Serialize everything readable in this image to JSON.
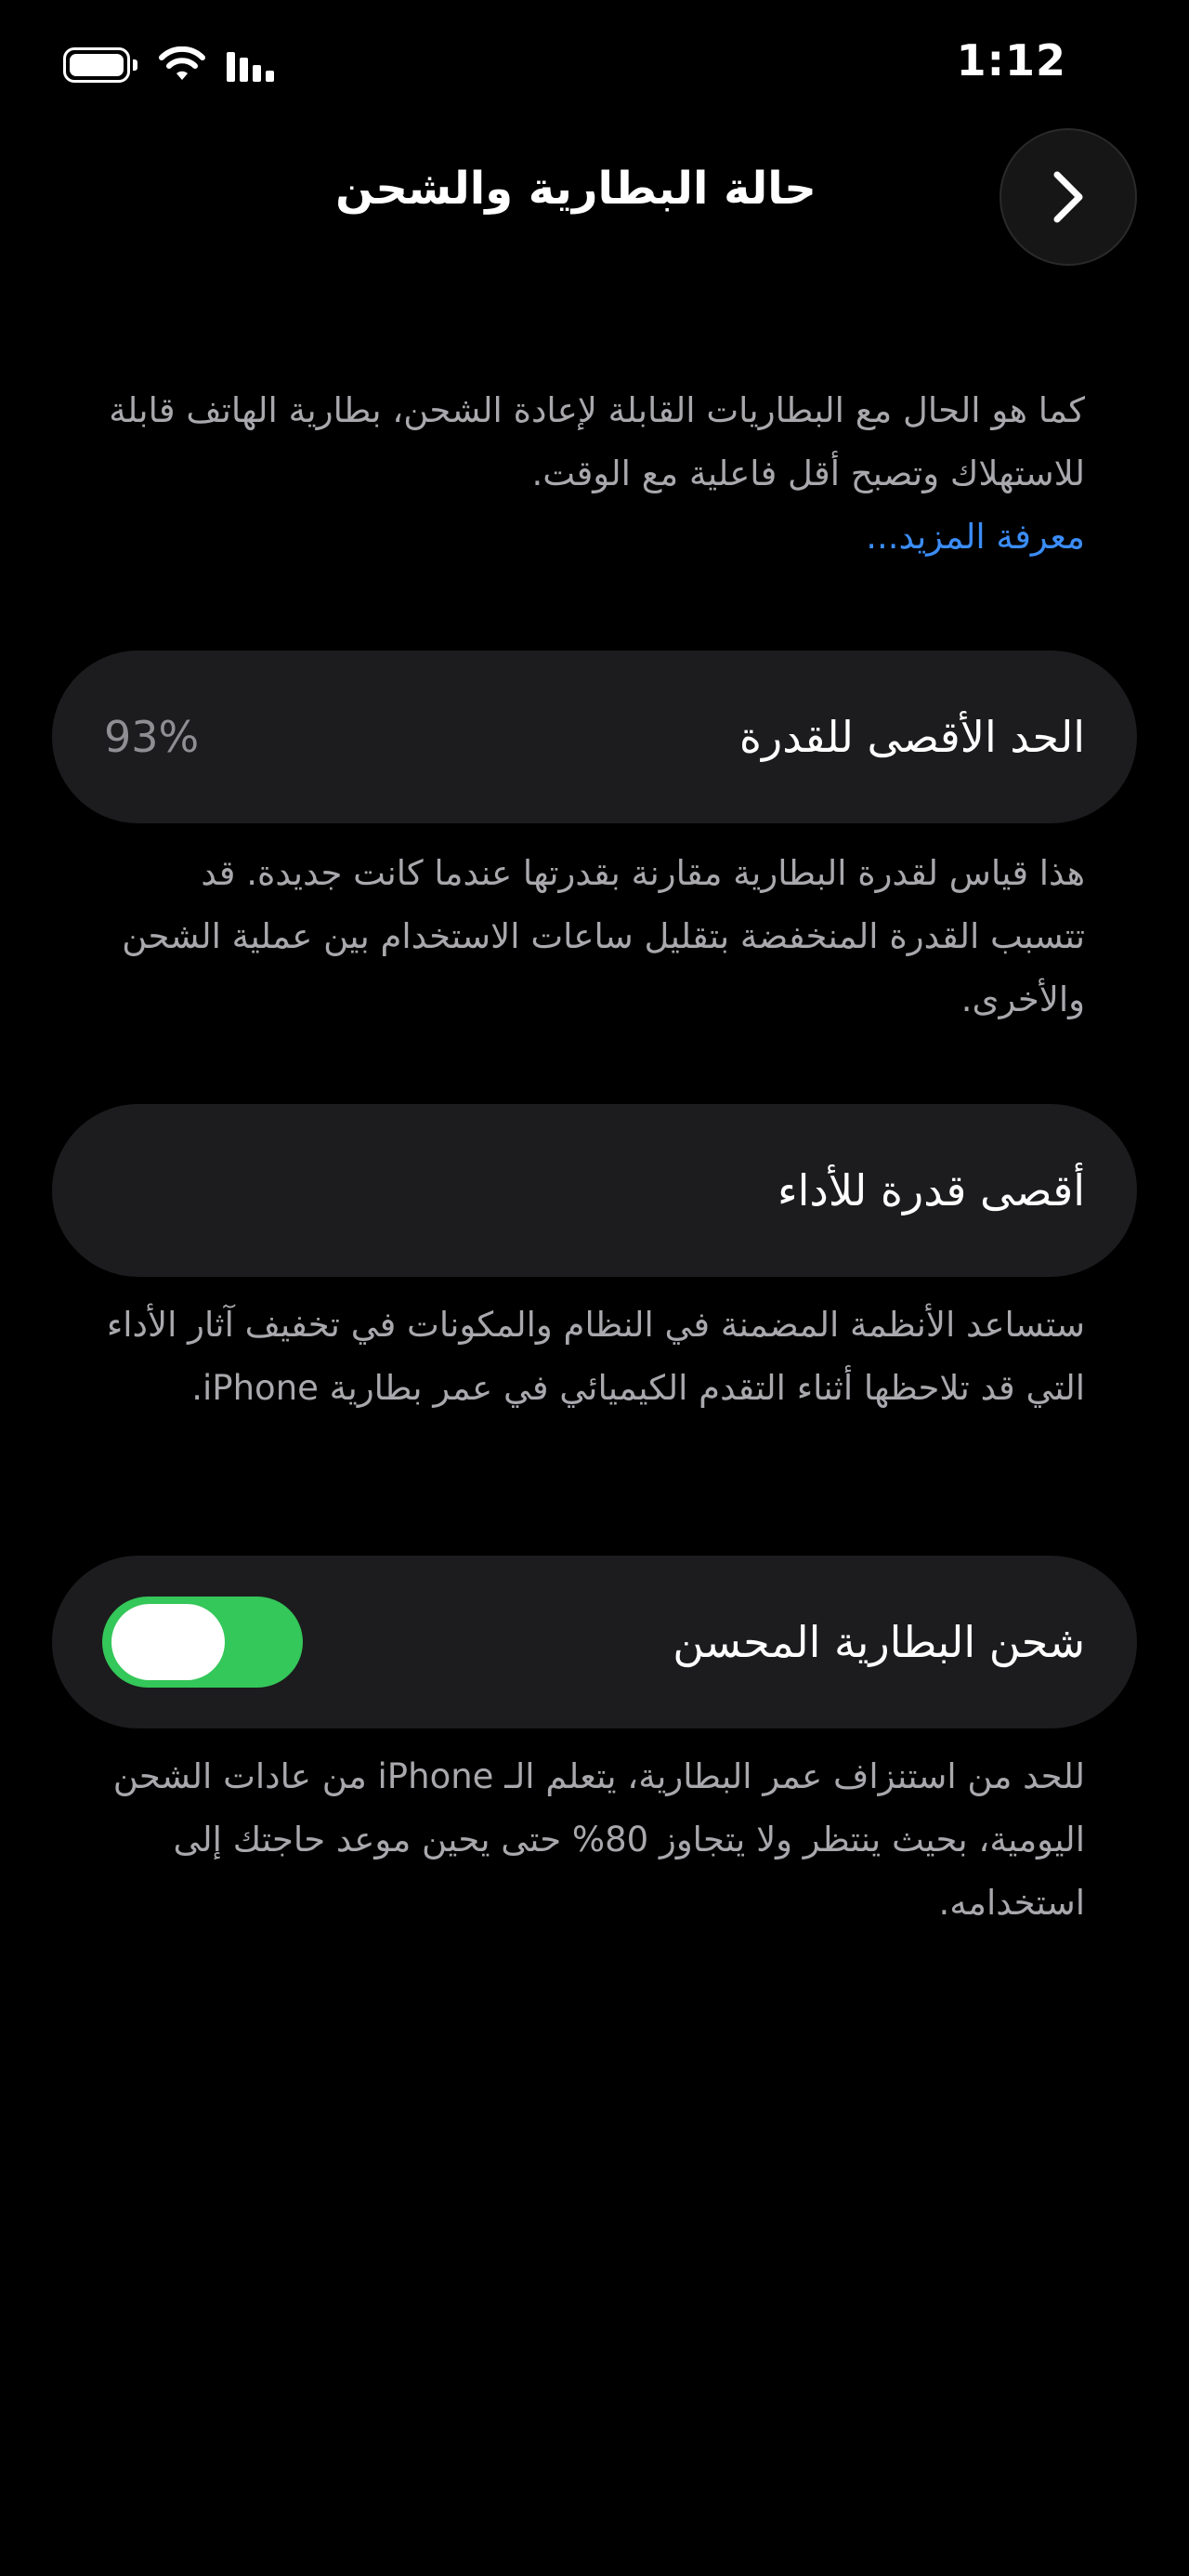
{
  "status_bar": {
    "time": "1:12"
  },
  "nav": {
    "title": "حالة البطارية والشحن"
  },
  "intro": {
    "text": "كما هو الحال مع البطاريات القابلة لإعادة الشحن، بطارية الهاتف قابلة للاستهلاك وتصبح أقل فاعلية مع الوقت.",
    "link": "معرفة المزيد..."
  },
  "max_capacity": {
    "label": "الحد الأقصى للقدرة",
    "value": "93%",
    "description": "هذا قياس لقدرة البطارية مقارنة بقدرتها عندما كانت جديدة. قد تتسبب القدرة المنخفضة بتقليل ساعات الاستخدام بين عملية الشحن والأخرى."
  },
  "peak_performance": {
    "label": "أقصى قدرة للأداء",
    "description": "ستساعد الأنظمة المضمنة في النظام والمكونات في تخفيف آثار الأداء التي قد تلاحظها أثناء التقدم الكيميائي في عمر بطارية iPhone."
  },
  "optimized_charging": {
    "label": "شحن البطارية المحسن",
    "enabled": true,
    "description": "للحد من استنزاف عمر البطارية، يتعلم الـ iPhone من عادات الشحن اليومية، بحيث ينتظر ولا يتجاوز 80% حتى يحين موعد حاجتك إلى استخدامه."
  },
  "colors": {
    "toggle_on": "#34c759",
    "link": "#3b8df7",
    "card": "#1c1c1e"
  }
}
